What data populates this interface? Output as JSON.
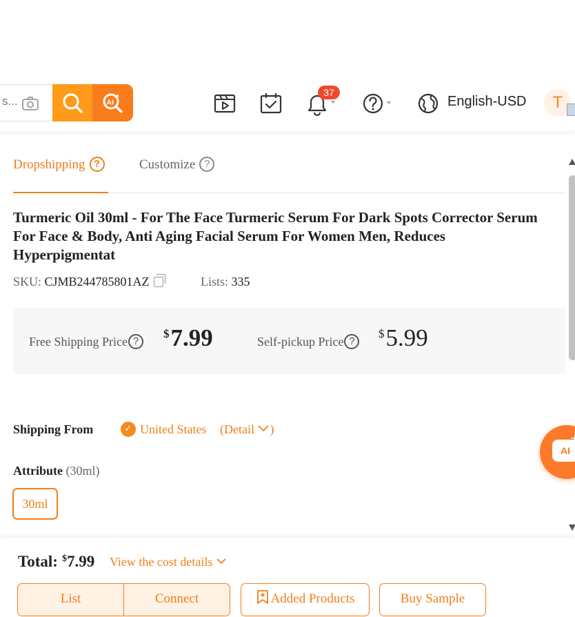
{
  "header": {
    "search_placeholder": "s...",
    "notification_count": "37",
    "language": "English-USD",
    "avatar_letter": "T"
  },
  "tabs": [
    {
      "label": "Dropshipping",
      "active": true
    },
    {
      "label": "Customize",
      "active": false
    }
  ],
  "product": {
    "title": "Turmeric Oil 30ml - For The Face Turmeric Serum For Dark Spots Corrector Serum For Face & Body, Anti Aging Facial Serum For Women Men, Reduces Hyperpigmentat",
    "sku_label": "SKU:",
    "sku": "CJMB244785801AZ",
    "lists_label": "Lists:",
    "lists": "335"
  },
  "pricing": {
    "free_shipping_label": "Free Shipping Price",
    "free_shipping_currency": "$",
    "free_shipping_price": "7.99",
    "self_pickup_label": "Self-pickup Price",
    "self_pickup_currency": "$",
    "self_pickup_price": "5.99"
  },
  "shipping": {
    "label": "Shipping From",
    "country": "United States",
    "detail_link": "(Detail"
  },
  "attribute": {
    "label": "Attribute",
    "selected": "(30ml)",
    "options": [
      "30ml"
    ]
  },
  "ai_float_label": "AI",
  "footer": {
    "total_label": "Total:",
    "total_currency": "$",
    "total_value": "7.99",
    "cost_details_link": "View the cost details",
    "list_button": "List",
    "connect_button": "Connect",
    "added_products_button": "Added Products",
    "buy_sample_button": "Buy Sample"
  },
  "colors": {
    "accent": "#f07f1a",
    "search_button": "#ff9a1a",
    "ai_button": "#fc7b1b",
    "badge": "#f04a2b"
  }
}
